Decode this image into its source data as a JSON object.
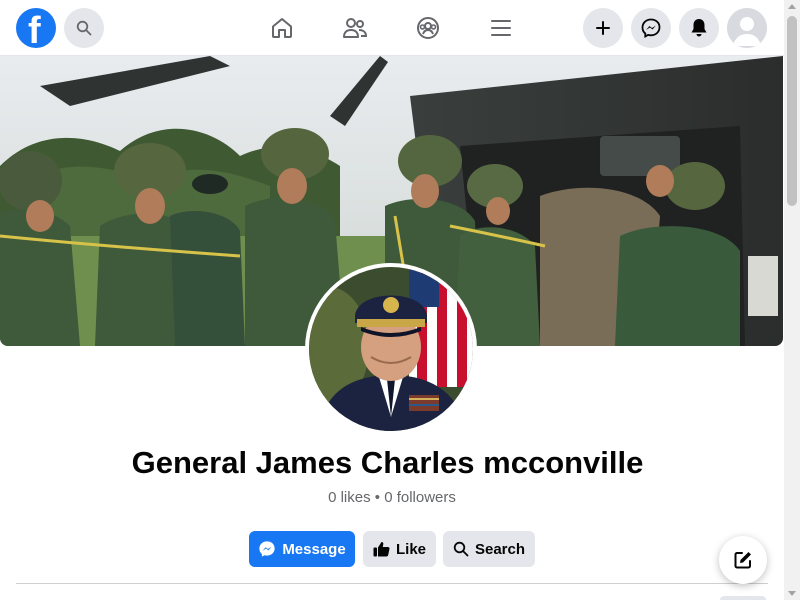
{
  "topbar": {
    "logo_letter": "f",
    "nav_icons": [
      "home-icon",
      "friends-icon",
      "groups-icon",
      "menu-icon"
    ],
    "right_icons": [
      "plus-icon",
      "messenger-icon",
      "bell-icon",
      "profile-avatar-icon"
    ]
  },
  "profile": {
    "name": "General James Charles mcconville",
    "stats": "0 likes • 0 followers"
  },
  "actions": {
    "message_label": "Message",
    "like_label": "Like",
    "search_label": "Search"
  },
  "colors": {
    "brand": "#1877f2",
    "secondary_button": "#e4e6eb",
    "text_primary": "#050505",
    "text_secondary": "#65676b"
  }
}
